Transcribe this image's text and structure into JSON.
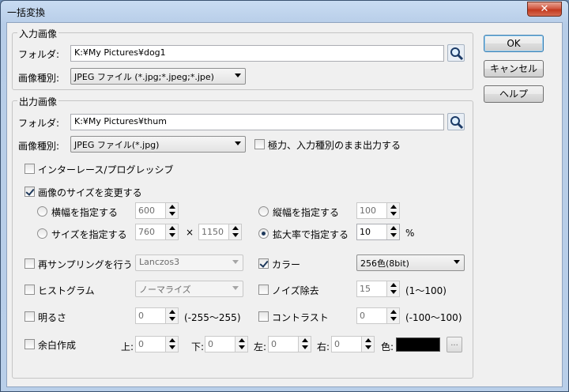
{
  "window": {
    "title": "一括変換",
    "close_glyph": "✕"
  },
  "buttons": {
    "ok": "OK",
    "cancel": "キャンセル",
    "help": "ヘルプ"
  },
  "input_group": {
    "legend": "入力画像",
    "folder_label": "フォルダ:",
    "folder_value": "K:¥My Pictures¥dog1",
    "type_label": "画像種別:",
    "type_value": "JPEG ファイル (*.jpg;*.jpeg;*.jpe)"
  },
  "output_group": {
    "legend": "出力画像",
    "folder_label": "フォルダ:",
    "folder_value": "K:¥My Pictures¥thum",
    "type_label": "画像種別:",
    "type_value": "JPEG ファイル(*.jpg)",
    "keep_type_label": "極力、入力種別のまま出力する",
    "keep_type_checked": false,
    "interlace_label": "インターレース/プログレッシブ",
    "interlace_checked": false,
    "resize_label": "画像のサイズを変更する",
    "resize_checked": true,
    "width_label": "横幅を指定する",
    "width_value": "600",
    "height_label": "縦幅を指定する",
    "height_value": "100",
    "size_label": "サイズを指定する",
    "size_w_value": "760",
    "times": "×",
    "size_h_value": "1150",
    "scale_label": "拡大率で指定する",
    "scale_value": "10",
    "percent": "%",
    "resample_label": "再サンプリングを行う",
    "resample_checked": false,
    "resample_value": "Lanczos3",
    "color_label": "カラー",
    "color_checked": true,
    "color_value": "256色(8bit)",
    "histogram_label": "ヒストグラム",
    "histogram_checked": false,
    "histogram_value": "ノーマライズ",
    "noise_label": "ノイズ除去",
    "noise_checked": false,
    "noise_value": "15",
    "noise_range": "(1〜100)",
    "brightness_label": "明るさ",
    "brightness_checked": false,
    "brightness_value": "0",
    "brightness_range": "(-255〜255)",
    "contrast_label": "コントラスト",
    "contrast_checked": false,
    "contrast_value": "0",
    "contrast_range": "(-100〜100)",
    "margin_label": "余白作成",
    "margin_checked": false,
    "top_label": "上:",
    "top_value": "0",
    "bottom_label": "下:",
    "bottom_value": "0",
    "left_label": "左:",
    "left_value": "0",
    "right_label": "右:",
    "right_value": "0",
    "color_pick_label": "色:",
    "margin_color": "#000000",
    "browse_label": "..."
  },
  "icons": {
    "folder_search": "search-icon"
  }
}
